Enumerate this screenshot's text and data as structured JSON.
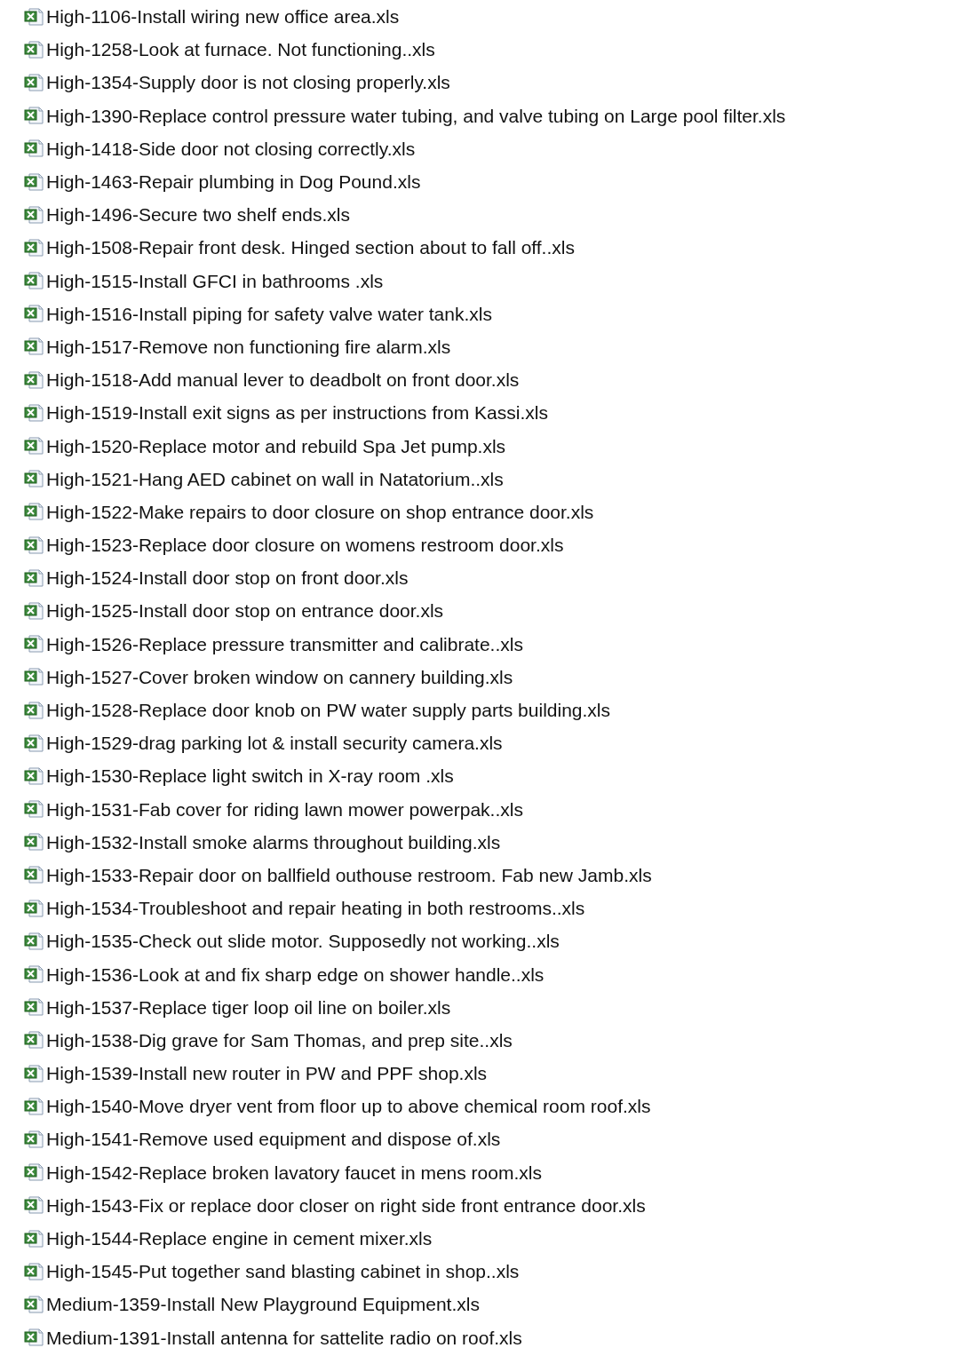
{
  "files": [
    {
      "name": "High-1106-Install wiring new office area.xls"
    },
    {
      "name": "High-1258-Look at furnace. Not functioning..xls"
    },
    {
      "name": "High-1354-Supply door is not closing properly.xls"
    },
    {
      "name": "High-1390-Replace control pressure water tubing, and valve tubing on Large pool filter.xls"
    },
    {
      "name": "High-1418-Side door not closing correctly.xls"
    },
    {
      "name": "High-1463-Repair plumbing in Dog Pound.xls"
    },
    {
      "name": "High-1496-Secure two shelf ends.xls"
    },
    {
      "name": "High-1508-Repair front desk. Hinged section about to fall off..xls"
    },
    {
      "name": "High-1515-Install GFCI in bathrooms .xls"
    },
    {
      "name": "High-1516-Install piping for safety valve water tank.xls"
    },
    {
      "name": "High-1517-Remove non functioning fire alarm.xls"
    },
    {
      "name": "High-1518-Add manual lever to deadbolt on front door.xls"
    },
    {
      "name": "High-1519-Install exit signs as per instructions from Kassi.xls"
    },
    {
      "name": "High-1520-Replace motor and rebuild Spa Jet pump.xls"
    },
    {
      "name": "High-1521-Hang AED cabinet on wall in Natatorium..xls"
    },
    {
      "name": "High-1522-Make repairs to door closure on shop entrance door.xls"
    },
    {
      "name": "High-1523-Replace door closure on womens restroom door.xls"
    },
    {
      "name": "High-1524-Install door stop on front door.xls"
    },
    {
      "name": "High-1525-Install door stop on entrance door.xls"
    },
    {
      "name": "High-1526-Replace pressure transmitter and calibrate..xls"
    },
    {
      "name": "High-1527-Cover broken window on cannery building.xls"
    },
    {
      "name": "High-1528-Replace door knob on PW water supply parts building.xls"
    },
    {
      "name": "High-1529-drag parking lot & install security camera.xls"
    },
    {
      "name": "High-1530-Replace light switch in X-ray room .xls"
    },
    {
      "name": "High-1531-Fab cover for riding lawn mower powerpak..xls"
    },
    {
      "name": "High-1532-Install smoke alarms throughout building.xls"
    },
    {
      "name": "High-1533-Repair door on ballfield outhouse restroom. Fab new Jamb.xls"
    },
    {
      "name": "High-1534-Troubleshoot and repair heating in both restrooms..xls"
    },
    {
      "name": "High-1535-Check out slide motor. Supposedly not working..xls"
    },
    {
      "name": "High-1536-Look at and fix sharp edge on shower handle..xls"
    },
    {
      "name": "High-1537-Replace tiger loop oil line on boiler.xls"
    },
    {
      "name": "High-1538-Dig grave for Sam Thomas, and prep site..xls"
    },
    {
      "name": "High-1539-Install new router in PW and PPF shop.xls"
    },
    {
      "name": "High-1540-Move dryer vent from floor up to above chemical room roof.xls"
    },
    {
      "name": "High-1541-Remove used equipment and dispose of.xls"
    },
    {
      "name": "High-1542-Replace broken lavatory faucet in mens room.xls"
    },
    {
      "name": "High-1543-Fix or replace door closer on right side front entrance door.xls"
    },
    {
      "name": "High-1544-Replace engine in cement mixer.xls"
    },
    {
      "name": "High-1545-Put together sand blasting cabinet in shop..xls"
    },
    {
      "name": "Medium-1359-Install New Playground Equipment.xls"
    },
    {
      "name": "Medium-1391-Install antenna for sattelite radio on roof.xls"
    }
  ]
}
